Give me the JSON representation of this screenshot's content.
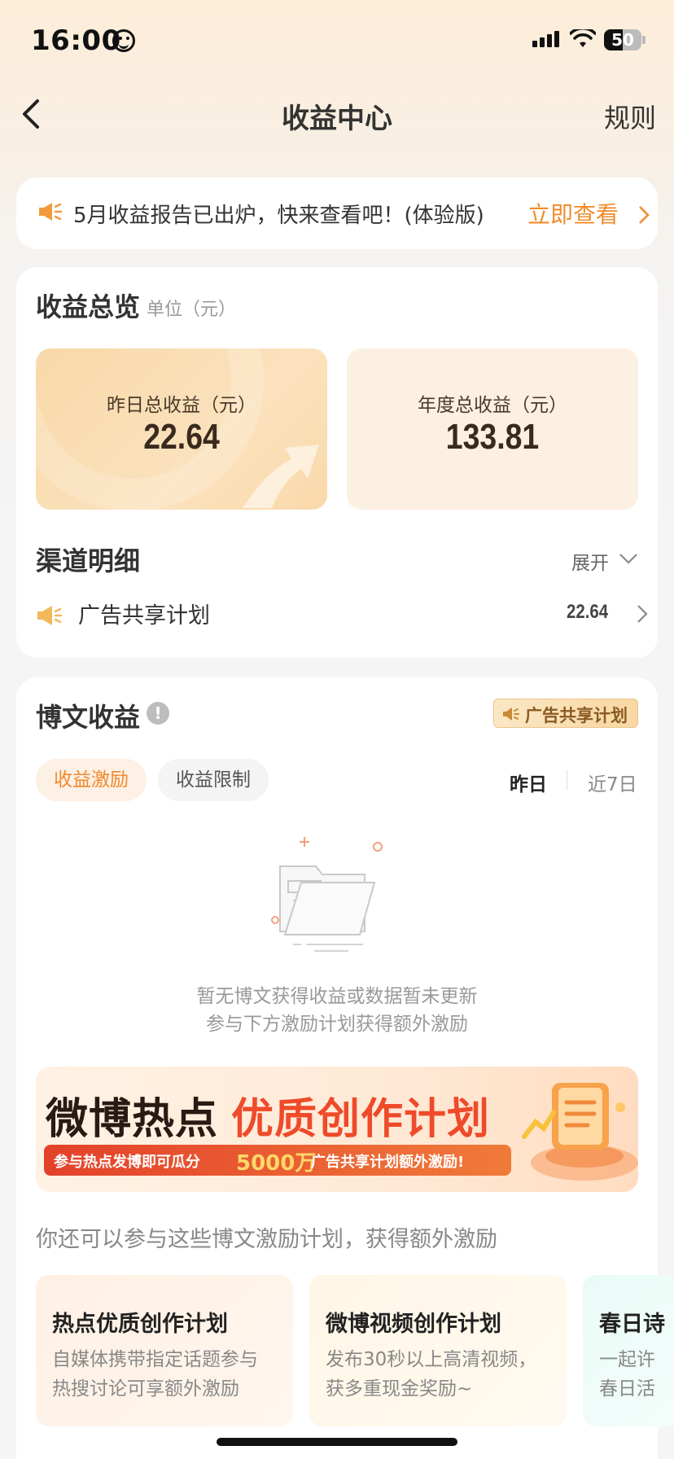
{
  "status_bar": {
    "time": "16:00",
    "battery": "50",
    "battery_level": 0.5
  },
  "header": {
    "title": "收益中心",
    "rules": "规则"
  },
  "notice": {
    "text": "5月收益报告已出炉，快来查看吧！(体验版)",
    "link": "立即查看"
  },
  "overview": {
    "title": "收益总览",
    "unit": "单位（元）",
    "yesterday": {
      "label": "昨日总收益（元）",
      "value": "22.64"
    },
    "annual": {
      "label": "年度总收益（元）",
      "value": "133.81"
    },
    "channel_title": "渠道明细",
    "expand": "展开",
    "channel": {
      "name": "广告共享计划",
      "value": "22.64"
    }
  },
  "posts": {
    "title": "博文收益",
    "badge": "广告共享计划",
    "tabs": [
      "收益激励",
      "收益限制"
    ],
    "ranges": [
      "昨日",
      "近7日"
    ],
    "empty_line1": "暂无博文获得收益或数据暂未更新",
    "empty_line2": "参与下方激励计划获得额外激励",
    "banner": {
      "title_dark": "微博热点",
      "title_red": "优质创作计划",
      "sub1": "参与热点发博即可瓜分",
      "amount": "5000万",
      "sub2": "广告共享计划额外激励!"
    },
    "more_desc": "你还可以参与这些博文激励计划，获得额外激励",
    "plans": [
      {
        "title": "热点优质创作计划",
        "desc1": "自媒体携带指定话题参与",
        "desc2": "热搜讨论可享额外激励"
      },
      {
        "title": "微博视频创作计划",
        "desc1": "发布30秒以上高清视频，",
        "desc2": "获多重现金奖励~"
      },
      {
        "title": "春日诗",
        "desc1": "一起许",
        "desc2": "春日活"
      }
    ]
  },
  "colors": {
    "accent": "#f08c2c",
    "banner_red": "#ef4a2a",
    "amount_yellow": "#ffd86a"
  }
}
